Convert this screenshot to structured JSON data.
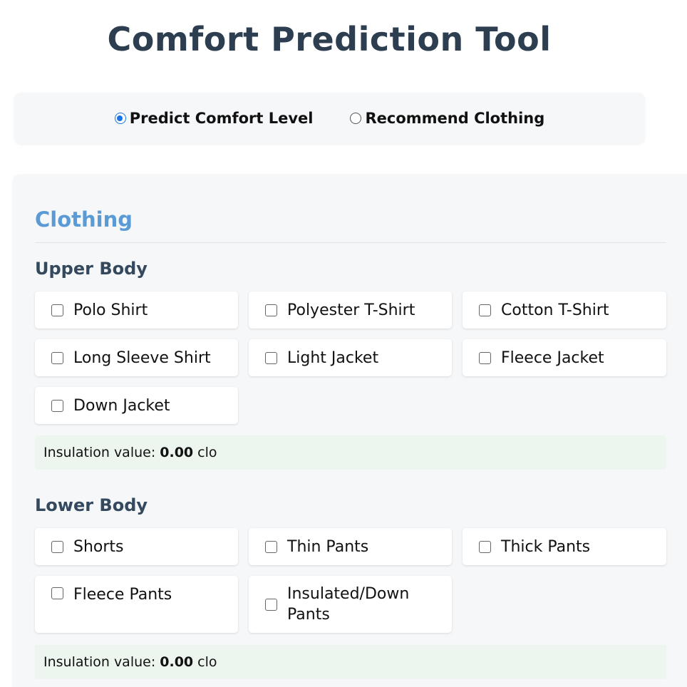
{
  "page": {
    "title": "Comfort Prediction Tool"
  },
  "mode": {
    "options": [
      {
        "label": "Predict Comfort Level",
        "selected": true
      },
      {
        "label": "Recommend Clothing",
        "selected": false
      }
    ]
  },
  "clothing": {
    "title": "Clothing",
    "upper": {
      "title": "Upper Body",
      "items": [
        {
          "label": "Polo Shirt",
          "checked": false
        },
        {
          "label": "Polyester T-Shirt",
          "checked": false
        },
        {
          "label": "Cotton T-Shirt",
          "checked": false
        },
        {
          "label": "Long Sleeve Shirt",
          "checked": false
        },
        {
          "label": "Light Jacket",
          "checked": false
        },
        {
          "label": "Fleece Jacket",
          "checked": false
        },
        {
          "label": "Down Jacket",
          "checked": false
        }
      ],
      "insulation": {
        "prefix": "Insulation value:",
        "value": "0.00",
        "unit": "clo"
      }
    },
    "lower": {
      "title": "Lower Body",
      "items": [
        {
          "label": "Shorts",
          "checked": false
        },
        {
          "label": "Thin Pants",
          "checked": false
        },
        {
          "label": "Thick Pants",
          "checked": false
        },
        {
          "label": "Fleece Pants",
          "checked": false
        },
        {
          "label": "Insulated/Down Pants",
          "checked": false
        }
      ],
      "insulation": {
        "prefix": "Insulation value:",
        "value": "0.00",
        "unit": "clo"
      }
    }
  },
  "colors": {
    "title": "#2c3e50",
    "section_title": "#5b9bd5",
    "group_title": "#34495e",
    "accent": "#1a73e8",
    "panel_bg": "#f5f7f9",
    "insulation_bg": "#edf6ee"
  }
}
